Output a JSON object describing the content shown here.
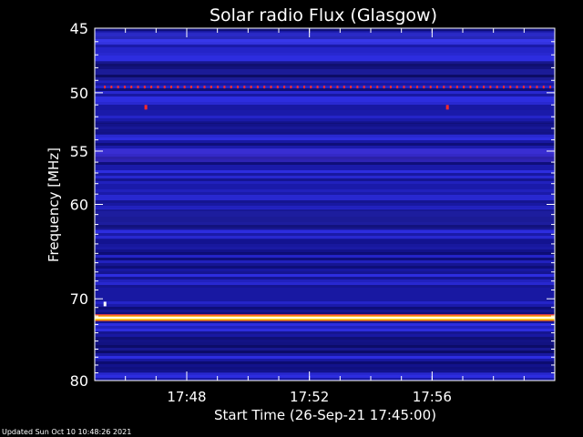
{
  "footer_text": "Updated Sun Oct 10 10:48:26 2021",
  "chart_data": {
    "type": "heatmap",
    "title": "Solar radio Flux (Glasgow)",
    "xlabel": "Start Time (26-Sep-21 17:45:00)",
    "ylabel": "Frequency [MHz]",
    "ylim": [
      45,
      80
    ],
    "yscale": "log",
    "grid": false,
    "y_ticks": [
      45,
      50,
      55,
      60,
      70,
      80
    ],
    "y_tick_labels": [
      "45",
      "50",
      "55",
      "60",
      "70",
      "80"
    ],
    "x_ticks": [
      "17:48",
      "17:52",
      "17:56"
    ],
    "x_range": [
      "17:45:00",
      "18:00:00"
    ],
    "colormap": [
      "#0a0a3a",
      "#1a1aa8",
      "#2a2af0",
      "#6a1ad0",
      "#c01a4a",
      "#ff4400",
      "#ffd000",
      "#ffffc0"
    ],
    "features": [
      {
        "type": "persistent-line",
        "freq_mhz": 72.2,
        "intensity": "maximum",
        "colors": [
          "#ffe36a",
          "#ffffc8"
        ]
      },
      {
        "type": "dotted-interference",
        "freq_mhz": 49.5,
        "intensity": "high",
        "color": "#ff2a2a"
      },
      {
        "type": "spot",
        "freq_mhz": 51.2,
        "time": "17:46:40",
        "color": "#ff2a2a"
      },
      {
        "type": "spot",
        "freq_mhz": 51.2,
        "time": "17:56:30",
        "color": "#ff2a2a"
      },
      {
        "type": "spot",
        "freq_mhz": 70.6,
        "time": "17:45:20",
        "color": "#ffffff"
      }
    ]
  }
}
